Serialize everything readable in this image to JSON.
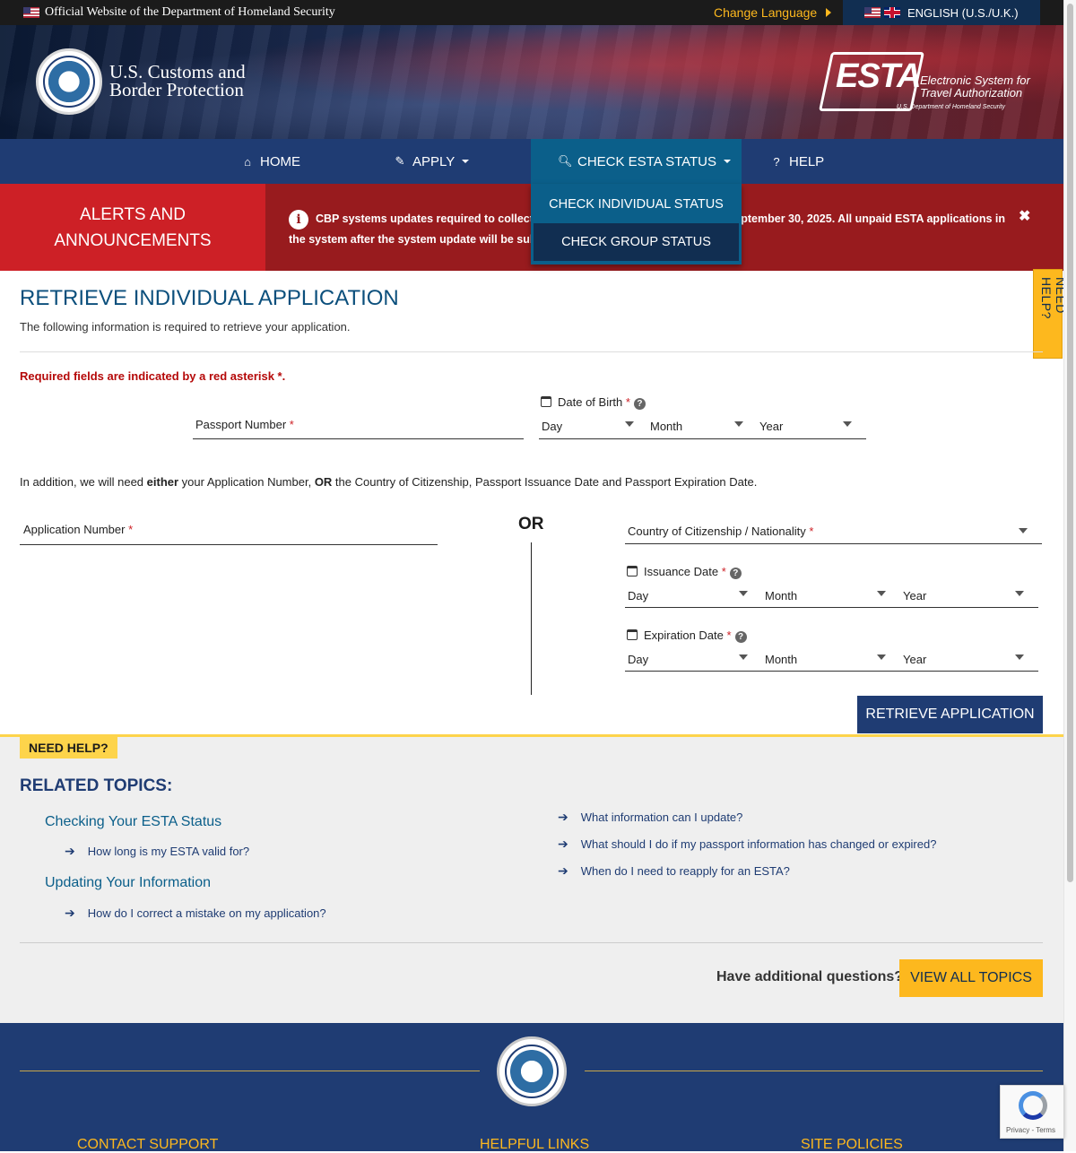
{
  "topbar": {
    "official_text": "Official Website of the Department of Homeland Security",
    "change_language": "Change Language",
    "language": "ENGLISH (U.S./U.K.)"
  },
  "header": {
    "agency_line1": "U.S. Customs and",
    "agency_line2": "Border Protection",
    "esta_word": "ESTA",
    "esta_tag_line1": "Electronic System for",
    "esta_tag_line2": "Travel Authorization",
    "esta_small": "U.S. Department of Homeland Security"
  },
  "nav": {
    "home": "HOME",
    "apply": "APPLY",
    "check_status": "CHECK ESTA STATUS",
    "help": "HELP",
    "status_menu": [
      "CHECK INDIVIDUAL STATUS",
      "CHECK GROUP STATUS"
    ]
  },
  "alerts": {
    "label_line1": "ALERTS AND",
    "label_line2": "ANNOUNCEMENTS",
    "message": "CBP systems updates required to collect the fee increase will be effective on September 30, 2025. All unpaid ESTA applications in the system after the system update will be subject to the new fee amount of $40."
  },
  "side_help": "NEED HELP?",
  "form": {
    "title": "RETRIEVE INDIVIDUAL APPLICATION",
    "subtitle": "The following information is required to retrieve your application.",
    "required_note": "Required fields are indicated by a red asterisk *.",
    "passport_label": "Passport Number",
    "dob_label": "Date of Birth",
    "day": "Day",
    "month": "Month",
    "year": "Year",
    "addition_pre": "In addition, we will need ",
    "addition_either": "either",
    "addition_mid": " your Application Number, ",
    "addition_or": "OR",
    "addition_post": " the Country of Citizenship, Passport Issuance Date and Passport Expiration Date.",
    "application_number_label": "Application Number",
    "or_label": "OR",
    "country_label": "Country of Citizenship / Nationality",
    "issuance_label": "Issuance Date",
    "expiration_label": "Expiration Date",
    "retrieve_button": "RETRIEVE APPLICATION",
    "asterisk": "*"
  },
  "help": {
    "tag": "NEED HELP?",
    "related_title": "RELATED TOPICS:",
    "cat1": "Checking Your ESTA Status",
    "cat1_links": [
      "How long is my ESTA valid for?"
    ],
    "cat2": "Updating Your Information",
    "cat2_links": [
      "How do I correct a mistake on my application?"
    ],
    "right_links": [
      "What information can I update?",
      "What should I do if my passport information has changed or expired?",
      "When do I need to reapply for an ESTA?"
    ],
    "have_questions": "Have additional questions?",
    "view_all": "VIEW ALL TOPICS"
  },
  "footer": {
    "contact": "CONTACT SUPPORT",
    "helpful": "HELPFUL LINKS",
    "policies": "SITE POLICIES"
  },
  "recaptcha": "Privacy - Terms",
  "colors": {
    "nav_blue": "#1f3c73",
    "active_blue": "#0b5f8a",
    "alert_red": "#cd2026",
    "alert_dark_red": "#981b1e",
    "gold": "#fdb81e"
  }
}
